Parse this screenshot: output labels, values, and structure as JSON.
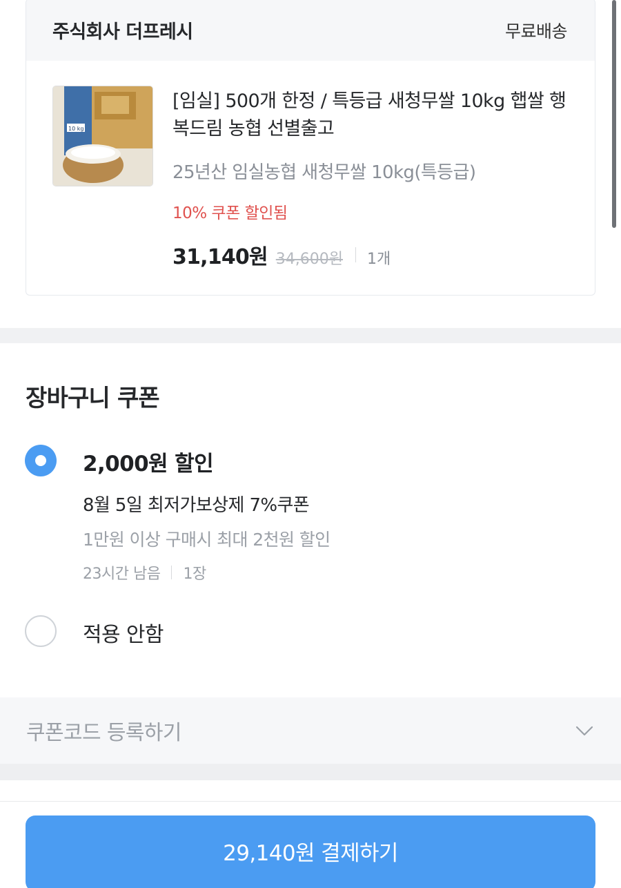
{
  "order": {
    "seller": "주식회사 더프레시",
    "shipping": "무료배송",
    "product": {
      "title": "[임실] 500개 한정 / 특등급 새청무쌀 10kg 햅쌀 행복드림 농협 선별출고",
      "option": "25년산 임실농협 새청무쌀 10kg(특등급)",
      "coupon_applied": "10% 쿠폰 할인됨",
      "price": "31,140원",
      "original_price": "34,600원",
      "quantity": "1개",
      "image_icon": "rice-bag-product-photo",
      "bag_label": "10 kg"
    }
  },
  "cart_coupon": {
    "title": "장바구니 쿠폰",
    "options": [
      {
        "amount": "2,000원 할인",
        "name": "8월 5일 최저가보상제 7%쿠폰",
        "condition": "1만원 이상 구매시 최대 2천원 할인",
        "remaining": "23시간 남음",
        "count": "1장",
        "selected": true
      },
      {
        "amount": "적용 안함",
        "selected": false
      }
    ]
  },
  "coupon_code": {
    "label": "쿠폰코드 등록하기",
    "icon": "chevron-down-icon"
  },
  "checkout": {
    "button_label": "29,140원 결제하기"
  },
  "colors": {
    "accent": "#4b9cf2",
    "discount_red": "#e0524f",
    "muted": "#9ba0a7"
  }
}
